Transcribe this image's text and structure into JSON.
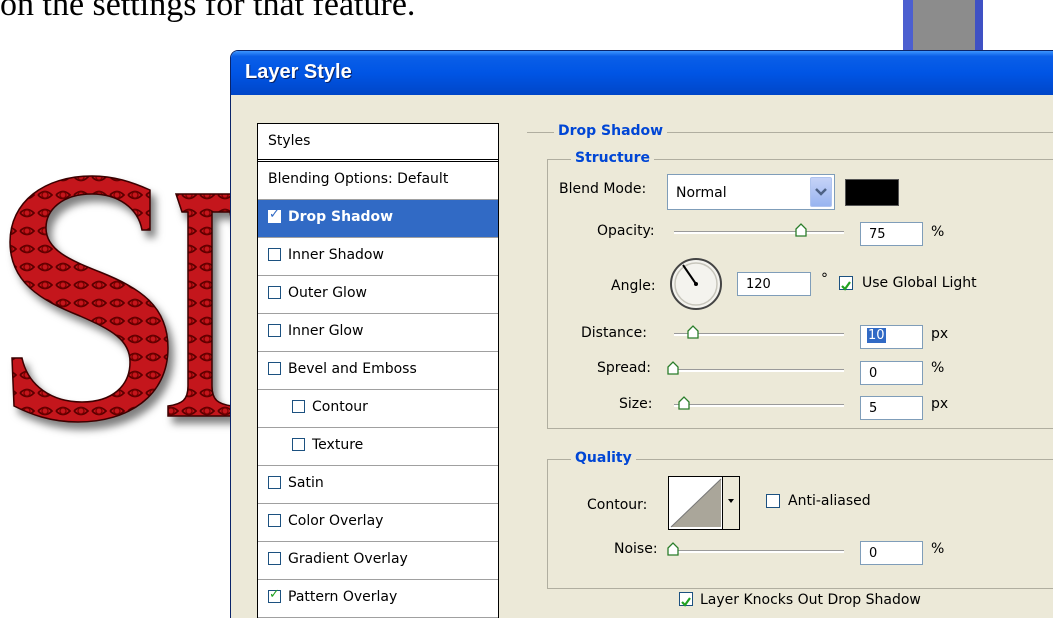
{
  "background": {
    "caption_fragment": "on the settings for that feature."
  },
  "dialog": {
    "title": "Layer Style",
    "styles_list": {
      "header": "Styles",
      "items": [
        {
          "label": "Blending Options: Default",
          "has_checkbox": false,
          "checked": false,
          "selected": false,
          "indent": false
        },
        {
          "label": "Drop Shadow",
          "has_checkbox": true,
          "checked": true,
          "selected": true,
          "indent": false
        },
        {
          "label": "Inner Shadow",
          "has_checkbox": true,
          "checked": false,
          "selected": false,
          "indent": false
        },
        {
          "label": "Outer Glow",
          "has_checkbox": true,
          "checked": false,
          "selected": false,
          "indent": false
        },
        {
          "label": "Inner Glow",
          "has_checkbox": true,
          "checked": false,
          "selected": false,
          "indent": false
        },
        {
          "label": "Bevel and Emboss",
          "has_checkbox": true,
          "checked": false,
          "selected": false,
          "indent": false
        },
        {
          "label": "Contour",
          "has_checkbox": true,
          "checked": false,
          "selected": false,
          "indent": true
        },
        {
          "label": "Texture",
          "has_checkbox": true,
          "checked": false,
          "selected": false,
          "indent": true
        },
        {
          "label": "Satin",
          "has_checkbox": true,
          "checked": false,
          "selected": false,
          "indent": false
        },
        {
          "label": "Color Overlay",
          "has_checkbox": true,
          "checked": false,
          "selected": false,
          "indent": false
        },
        {
          "label": "Gradient Overlay",
          "has_checkbox": true,
          "checked": false,
          "selected": false,
          "indent": false
        },
        {
          "label": "Pattern Overlay",
          "has_checkbox": true,
          "checked": true,
          "selected": false,
          "indent": false
        }
      ]
    },
    "drop_shadow": {
      "section_title": "Drop Shadow",
      "structure": {
        "title": "Structure",
        "blend_mode_label": "Blend Mode:",
        "blend_mode_value": "Normal",
        "shadow_color": "#000000",
        "opacity_label": "Opacity:",
        "opacity_value": "75",
        "opacity_unit": "%",
        "angle_label": "Angle:",
        "angle_value": "120",
        "angle_unit": "°",
        "use_global_light_label": "Use Global Light",
        "use_global_light_checked": true,
        "distance_label": "Distance:",
        "distance_value": "10",
        "distance_unit": "px",
        "spread_label": "Spread:",
        "spread_value": "0",
        "spread_unit": "%",
        "size_label": "Size:",
        "size_value": "5",
        "size_unit": "px"
      },
      "quality": {
        "title": "Quality",
        "contour_label": "Contour:",
        "anti_aliased_label": "Anti-aliased",
        "anti_aliased_checked": false,
        "noise_label": "Noise:",
        "noise_value": "0",
        "noise_unit": "%"
      },
      "layer_knocks_out_label": "Layer Knocks Out Drop Shadow",
      "layer_knocks_out_checked": true
    },
    "colors": {
      "title_bar": "#0055e5",
      "selected_item": "#316ac5",
      "group_title": "#0046d5",
      "dialog_bg": "#ece9d8"
    }
  }
}
